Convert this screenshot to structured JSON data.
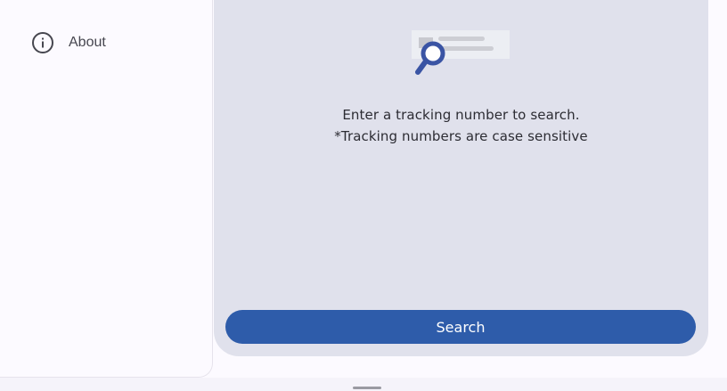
{
  "drawer": {
    "items": [
      {
        "label": "About",
        "icon": "info-icon"
      }
    ]
  },
  "main": {
    "illustration": "tracking-search-illustration",
    "message_line1": "Enter a tracking number to search.",
    "message_line2": "*Tracking numbers are case sensitive",
    "search_label": "Search"
  },
  "colors": {
    "primary": "#2e5caa",
    "surface_variant": "#e0e1ec",
    "background": "#fcfaff",
    "magnifier": "#3a54a4"
  }
}
